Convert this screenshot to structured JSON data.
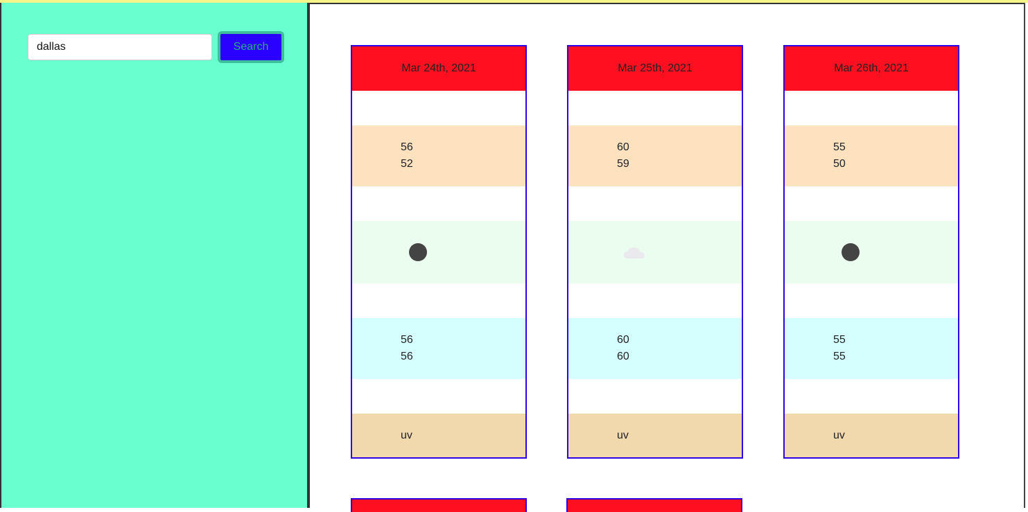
{
  "search": {
    "value": "dallas",
    "button_label": "Search"
  },
  "colors": {
    "sidebar": "#69ffce",
    "date_header": "#ff0f1f",
    "card_border": "#2b00e8",
    "temp_band": "#fee1bf",
    "icon_band": "#ebfdee",
    "feels_band": "#d5ffff",
    "uv_band": "#f1d9ad",
    "search_button": "#2a00ff"
  },
  "forecast": [
    {
      "date": "Mar 24th, 2021",
      "temp_high": "56",
      "temp_low": "52",
      "icon": "dark-dot-icon",
      "feels_1": "56",
      "feels_2": "56",
      "uv_label": "uv"
    },
    {
      "date": "Mar 25th, 2021",
      "temp_high": "60",
      "temp_low": "59",
      "icon": "cloud-icon",
      "feels_1": "60",
      "feels_2": "60",
      "uv_label": "uv"
    },
    {
      "date": "Mar 26th, 2021",
      "temp_high": "55",
      "temp_low": "50",
      "icon": "dark-dot-icon",
      "feels_1": "55",
      "feels_2": "55",
      "uv_label": "uv"
    }
  ]
}
